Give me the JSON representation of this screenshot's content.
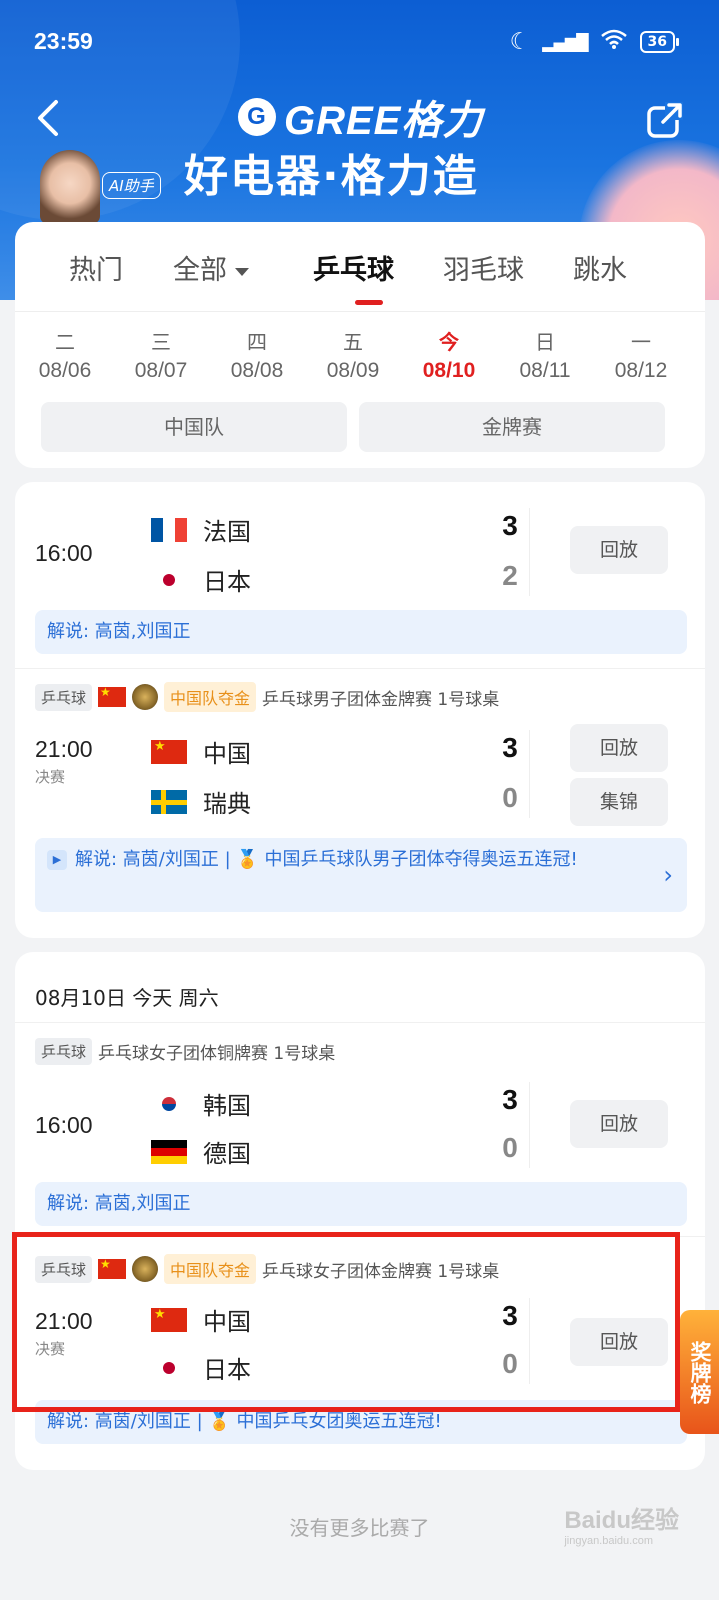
{
  "status_bar": {
    "time": "23:59",
    "battery": "36"
  },
  "header": {
    "brand": "GREE格力",
    "slogan": "好电器·格力造",
    "ai_badge": "AI助手"
  },
  "tabs": [
    {
      "label": "热门"
    },
    {
      "label": "全部"
    },
    {
      "label": "乒乓球"
    },
    {
      "label": "羽毛球"
    },
    {
      "label": "跳水"
    }
  ],
  "dates": [
    {
      "weekday": "二",
      "date": "08/06"
    },
    {
      "weekday": "三",
      "date": "08/07"
    },
    {
      "weekday": "四",
      "date": "08/08"
    },
    {
      "weekday": "五",
      "date": "08/09"
    },
    {
      "weekday": "今",
      "date": "08/10"
    },
    {
      "weekday": "日",
      "date": "08/11"
    },
    {
      "weekday": "一",
      "date": "08/12"
    }
  ],
  "filters": {
    "team": "中国队",
    "gold": "金牌赛"
  },
  "card1": {
    "match1": {
      "time": "16:00",
      "team_a": "法国",
      "score_a": "3",
      "team_b": "日本",
      "score_b": "2",
      "action": "回放",
      "commentary": "解说: 高茵,刘国正"
    },
    "match2": {
      "sport": "乒乓球",
      "gold_tag": "中国队夺金",
      "event": "乒乓球男子团体金牌赛 1号球桌",
      "time": "21:00",
      "stage": "决赛",
      "team_a": "中国",
      "score_a": "3",
      "team_b": "瑞典",
      "score_b": "0",
      "action1": "回放",
      "action2": "集锦",
      "commentary": "解说: 高茵/刘国正 | 🏅 中国乒乓球队男子团体夺得奥运五连冠!"
    }
  },
  "card2": {
    "day_header": "08月10日 今天 周六",
    "match1": {
      "sport": "乒乓球",
      "event": "乒乓球女子团体铜牌赛 1号球桌",
      "time": "16:00",
      "team_a": "韩国",
      "score_a": "3",
      "team_b": "德国",
      "score_b": "0",
      "action": "回放",
      "commentary": "解说: 高茵,刘国正"
    },
    "match2": {
      "sport": "乒乓球",
      "gold_tag": "中国队夺金",
      "event": "乒乓球女子团体金牌赛 1号球桌",
      "time": "21:00",
      "stage": "决赛",
      "team_a": "中国",
      "score_a": "3",
      "team_b": "日本",
      "score_b": "0",
      "action": "回放",
      "commentary": "解说: 高茵/刘国正 | 🏅 中国乒乓女团奥运五连冠!"
    }
  },
  "rank_tab": "奖牌榜",
  "footer": {
    "no_more": "没有更多比赛了"
  },
  "watermark": {
    "text": "Baidu经验",
    "sub": "jingyan.baidu.com"
  },
  "colors": {
    "primary_blue": "#1a74e0",
    "accent_red": "#e02020",
    "highlight_red": "#e8231a",
    "commentary_blue": "#2b6fd6"
  }
}
